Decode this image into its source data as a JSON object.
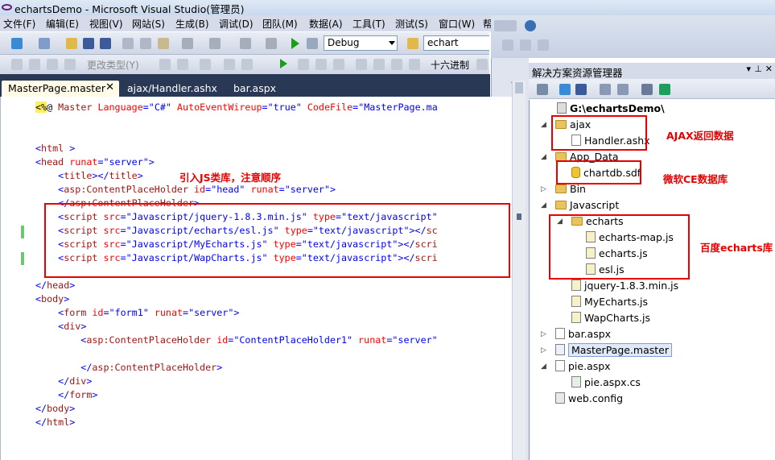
{
  "window": {
    "title": "echartsDemo - Microsoft Visual Studio(管理员)"
  },
  "menu": [
    "文件(F)",
    "编辑(E)",
    "视图(V)",
    "网站(S)",
    "生成(B)",
    "调试(D)",
    "团队(M)",
    "数据(A)",
    "工具(T)",
    "测试(S)",
    "窗口(W)",
    "帮"
  ],
  "toolbar": {
    "config": "Debug",
    "find": "echart",
    "hex_label": "十六进制",
    "change_type": "更改类型(Y)"
  },
  "tabs": [
    "MasterPage.master",
    "ajax/Handler.ashx",
    "bar.aspx"
  ],
  "code_lines": [
    "<%@ Master Language=\"C#\" AutoEventWireup=\"true\" CodeFile=\"MasterPage.ma",
    "",
    "",
    "<html >",
    "<head runat=\"server\">",
    "    <title></title>",
    "    <asp:ContentPlaceHolder id=\"head\" runat=\"server\">",
    "    </asp:ContentPlaceHolder>",
    "    <script src=\"Javascript/jquery-1.8.3.min.js\" type=\"text/javascript\"",
    "    <script src=\"Javascript/echarts/esl.js\" type=\"text/javascript\"></sc",
    "    <script src=\"Javascript/MyEcharts.js\" type=\"text/javascript\"></scri",
    "    <script src=\"Javascript/WapCharts.js\" type=\"text/javascript\"></scri",
    "",
    "</head>",
    "<body>",
    "    <form id=\"form1\" runat=\"server\">",
    "    <div>",
    "        <asp:ContentPlaceHolder id=\"ContentPlaceHolder1\" runat=\"server\"",
    "",
    "        </asp:ContentPlaceHolder>",
    "    </div>",
    "    </form>",
    "</body>",
    "</html>"
  ],
  "annotations": {
    "js_order": "引入JS类库，注意顺序",
    "ajax": "AJAX返回数据",
    "ce_db": "微软CE数据库",
    "echarts_lib": "百度echarts库"
  },
  "solution": {
    "title": "解决方案资源管理器",
    "root": "G:\\echartsDemo\\",
    "nodes": [
      "ajax",
      "Handler.ashx",
      "App_Data",
      "chartdb.sdf",
      "Bin",
      "Javascript",
      "echarts",
      "echarts-map.js",
      "echarts.js",
      "esl.js",
      "jquery-1.8.3.min.js",
      "MyEcharts.js",
      "WapCharts.js",
      "bar.aspx",
      "MasterPage.master",
      "pie.aspx",
      "pie.aspx.cs",
      "web.config"
    ]
  },
  "colors": {
    "tag": "#0000ff",
    "attr": "#ff0000",
    "string": "#0000ff",
    "element": "#a31515",
    "annotation": "#e80000"
  }
}
